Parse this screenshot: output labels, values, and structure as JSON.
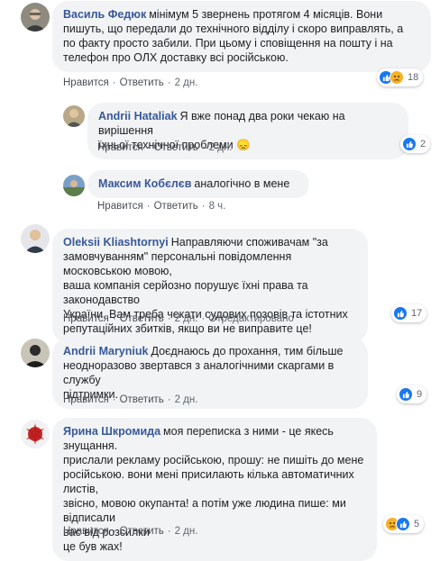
{
  "colors": {
    "author": "#385898",
    "bubble": "#f2f3f5",
    "like": "#1877f2",
    "sad": "#f7b125"
  },
  "comments": [
    {
      "author": "Василь Федюк",
      "lines": [
        "мінімум 5 звернень протягом 4 місяців. Вони",
        "пишуть, що передали до технічного відділу і скоро виправлять, а",
        "по факту просто забили. При цьому і сповіщення на пошту і на",
        "телефон про ОЛХ доставку всі російською."
      ],
      "like": "Нравится",
      "reply": "Ответить",
      "time": "2 дн.",
      "reactions": [
        "like-icon",
        "sad-icon"
      ],
      "reaction_count": "18"
    },
    {
      "author": "Andrii Hataliak",
      "lines": [
        "Я вже понад два роки чекаю на вирішення",
        "їхньої технічної проблеми 😞"
      ],
      "like": "Нравится",
      "reply": "Ответить",
      "time": "2 дн.",
      "reactions": [
        "like-icon"
      ],
      "reaction_count": "2"
    },
    {
      "author": "Максим Кобєлєв",
      "lines": [
        "аналогічно в мене"
      ],
      "like": "Нравится",
      "reply": "Ответить",
      "time": "8 ч."
    },
    {
      "author": "Oleksii Kliashtornyi",
      "lines": [
        "Направляючи споживачам \"за",
        "замовчуванням\" персональні повідомлення московською мовою,",
        "ваша компанія серйозно порушує їхні права та законодавство",
        "України. Вам треба чекати судових позовів та істотних",
        "репутаційних збитків, якщо ви не виправите це!"
      ],
      "like": "Нравится",
      "reply": "Ответить",
      "time": "2 дн.",
      "edited": "Отредактировано",
      "reactions": [
        "like-icon"
      ],
      "reaction_count": "17"
    },
    {
      "author": "Andrii Maryniuk",
      "lines": [
        "Доєднаюсь до прохання, тим більше",
        "неодноразово звертався з аналогічними скаргами в службу",
        "підтримки."
      ],
      "like": "Нравится",
      "reply": "Ответить",
      "time": "2 дн.",
      "reactions": [
        "like-icon"
      ],
      "reaction_count": "9"
    },
    {
      "author": "Ярина Шкромида",
      "lines": [
        "моя переписка з ними - це якесь знущання.",
        "прислали рекламу російською, прошу: не пишіть до мене",
        "російською. вони мені присилають кілька автоматичних листів,",
        "звісно, мовою окупанта! а потім уже людина пише: ми відписали",
        "вас від розсилки",
        "це був жах!"
      ],
      "like": "Нравится",
      "reply": "Ответить",
      "time": "2 дн.",
      "reactions": [
        "sad-icon",
        "like-icon"
      ],
      "reaction_count": "5"
    }
  ]
}
